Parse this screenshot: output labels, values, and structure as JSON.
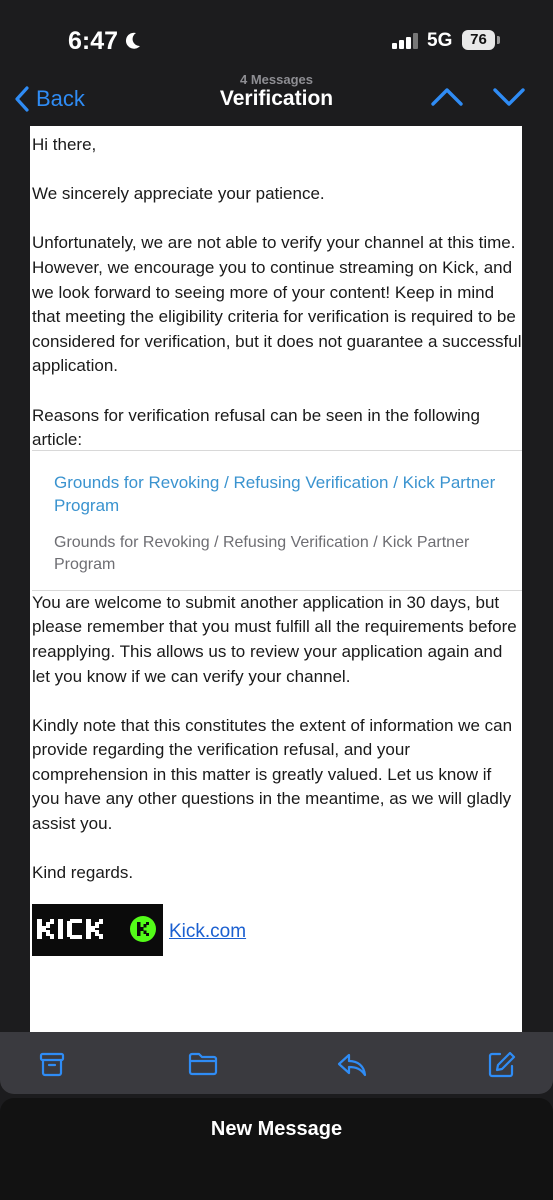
{
  "status_bar": {
    "time": "6:47",
    "network": "5G",
    "battery": "76"
  },
  "nav": {
    "back_label": "Back",
    "message_count": "4 Messages",
    "title": "Verification"
  },
  "email": {
    "greeting": "Hi there,",
    "p1": "We sincerely appreciate your patience.",
    "p2": "Unfortunately, we are not able to verify your channel at this time. However, we encourage you to continue streaming on Kick, and we look forward to seeing more of your content! Keep in mind that meeting the eligibility criteria for verification is required to be considered for verification, but it does not guarantee a successful application.",
    "p3": "Reasons for verification refusal can be seen in the following article:",
    "link_card": {
      "title": "Grounds for Revoking / Refusing Verification / Kick Partner Program",
      "description": "Grounds for Revoking / Refusing Verification / Kick Partner Program"
    },
    "p4": "You are welcome to submit another application in 30 days, but please remember that you must fulfill all the requirements before reapplying. This allows us to review your application again and let you know if we can verify your channel.",
    "p5": "Kindly note that this constitutes the extent of information we can provide regarding the verification refusal, and your comprehension in this matter is greatly valued. Let us know if you have any other questions in the meantime, as we will gladly assist you.",
    "closing": "Kind regards.",
    "signature_logo_text": "KICK",
    "signature_link": "Kick.com"
  },
  "toolbar": {
    "icons": [
      "archive-icon",
      "folder-icon",
      "reply-icon",
      "compose-icon"
    ]
  },
  "sheet": {
    "label": "New Message"
  },
  "colors": {
    "accent": "#2f8cf5",
    "kick_green": "#53fc18",
    "link_card_blue": "#3a93cf"
  }
}
